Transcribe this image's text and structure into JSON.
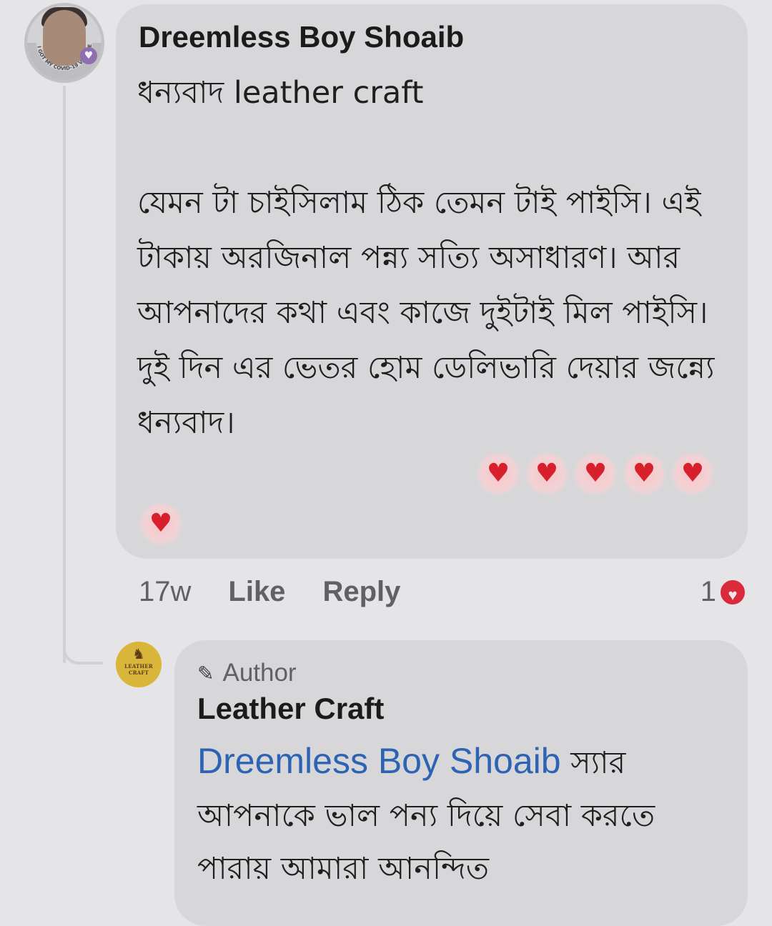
{
  "comment": {
    "author": "Dreemless Boy Shoaib",
    "avatar_ring_text": "I GOT MY COVID-19 VACCINE",
    "text": "ধন্যবাদ leather craft\n\nযেমন টা চাইসিলাম ঠিক তেমন টাই পাইসি। এই টাকায় অরজিনাল পন্ন্য সত্যি অসাধারণ। আর আপনাদের কথা এবং কাজে দুইটাই মিল পাইসি। দুই দিন এর ভেতর হোম ডেলিভারি দেয়ার জন্ন্যে ধন্যবাদ।",
    "emoji": [
      "heart",
      "heart",
      "heart",
      "heart",
      "heart",
      "heart"
    ],
    "timestamp": "17w",
    "like_label": "Like",
    "reply_label": "Reply",
    "reaction_count": "1",
    "reaction_type": "love"
  },
  "reply": {
    "badge_label": "Author",
    "badge_icon": "pencil-icon",
    "author": "Leather Craft",
    "avatar_text": "LEATHER CRAFT",
    "mention": "Dreemless Boy Shoaib",
    "text": " স্যার আপনাকে ভাল পন্য দিয়ে সেবা করতে পারায় আমারা আনন্দিত"
  },
  "colors": {
    "background": "#e5e5e8",
    "bubble": "#d7d7da",
    "mention": "#2d63b3",
    "love": "#d92b3c",
    "heart": "#d81f2c"
  }
}
